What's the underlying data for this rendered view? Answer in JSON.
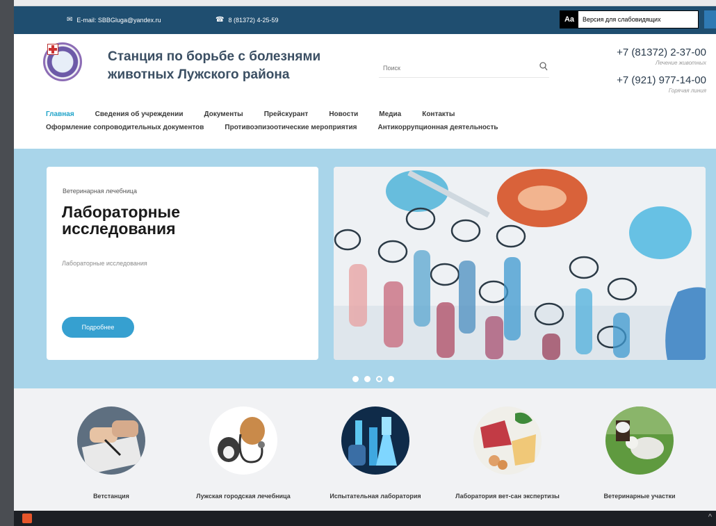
{
  "topbar": {
    "email": "E-mail: SBBGluga@yandex.ru",
    "phone": "8 (81372) 4-25-59",
    "vi_icon": "Aa",
    "vi_label": "Версия для слабовидящих"
  },
  "header": {
    "title": "Станция по борьбе с болезнями животных Лужского района",
    "search_placeholder": "Поиск",
    "phones": [
      {
        "number": "+7 (81372) 2-37-00",
        "caption": "Лечение животных"
      },
      {
        "number": "+7 (921) 977-14-00",
        "caption": "Горячая линия"
      }
    ]
  },
  "nav": {
    "row1": [
      "Главная",
      "Сведения об учреждении",
      "Документы",
      "Прейскурант",
      "Новости",
      "Медиа",
      "Контакты"
    ],
    "row2": [
      "Оформление сопроводительных документов",
      "Противоэпизоотические мероприятия",
      "Антикоррупционная деятельность"
    ],
    "active": "Главная"
  },
  "slider": {
    "kicker": "Ветеринарная лечебница",
    "title": "Лабораторные исследования",
    "description": "Лабораторные исследования",
    "button": "Подробнее",
    "dots_count": 4,
    "active_dot": 3
  },
  "categories": [
    {
      "label": "Ветстанция",
      "icon": "document-signing-icon"
    },
    {
      "label": "Лужская городская лечебница",
      "icon": "pets-stethoscope-icon"
    },
    {
      "label": "Испытательная лаборатория",
      "icon": "lab-flasks-icon"
    },
    {
      "label": "Лаборатория вет-сан экспертизы",
      "icon": "food-products-icon"
    },
    {
      "label": "Ветеринарные участки",
      "icon": "farm-animals-icon"
    }
  ],
  "colors": {
    "topbar": "#1f4e70",
    "accent": "#1fa3c9",
    "slider_bg": "#a9d5ea",
    "button": "#36a0d0"
  }
}
